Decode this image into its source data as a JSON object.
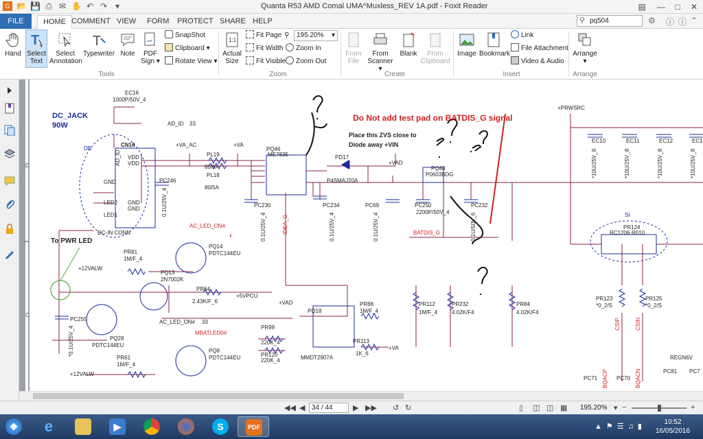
{
  "window": {
    "title": "Quanta R53 AMD Comal UMA^Muxless_REV 1A.pdf - Foxit Reader"
  },
  "menu": {
    "tabs": [
      "FILE",
      "HOME",
      "COMMENT",
      "VIEW",
      "FORM",
      "PROTECT",
      "SHARE",
      "HELP"
    ],
    "active": "HOME",
    "search_value": "pq504"
  },
  "ribbon": {
    "tools": {
      "hand": "Hand",
      "select_text": [
        "Select",
        "Text"
      ],
      "select_annotation": [
        "Select",
        "Annotation"
      ],
      "typewriter": "Typewriter",
      "note": "Note",
      "pdf_sign": [
        "PDF",
        "Sign"
      ],
      "snapshot": "SnapShot",
      "clipboard": "Clipboard",
      "rotate_view": "Rotate View",
      "group": "Tools"
    },
    "zoom": {
      "actual_size": [
        "Actual",
        "Size"
      ],
      "fit_page": "Fit Page",
      "fit_width": "Fit Width",
      "fit_visible": "Fit Visible",
      "zoom_value": "195.20%",
      "zoom_in": "Zoom In",
      "zoom_out": "Zoom Out",
      "group": "Zoom"
    },
    "create": {
      "from_file": [
        "From",
        "File"
      ],
      "from_scanner": [
        "From",
        "Scanner"
      ],
      "blank": "Blank",
      "from_clipboard": [
        "From",
        "Clipboard"
      ],
      "group": "Create"
    },
    "insert": {
      "image": "Image",
      "bookmark": "Bookmark",
      "link": "Link",
      "file_attachment": "File Attachment",
      "video_audio": "Video & Audio",
      "group": "Insert"
    },
    "arrange": {
      "arrange": "Arrange",
      "group": "Arrange"
    }
  },
  "schematic": {
    "labels": {
      "dc_jack": "DC_JACK",
      "w90": "90W",
      "ec16": "EC16",
      "ec16_val": "1000P/50V_4",
      "ad_id": "AD_ID",
      "n33a": "33",
      "db": "DB",
      "cn16": "CN16",
      "ad_id_pin": "AD_ID",
      "vdd1": "VDD",
      "vdd2": "VDD",
      "gnd": "GND",
      "led2": "LED2",
      "led1": "LED1",
      "gnd2": "GND",
      "gnd3": "GND",
      "dcin": "DC-IN CONN",
      "va_ac": "+VA_AC",
      "va": "+VA",
      "pl19": "PL19",
      "pl19_val": "80/5A",
      "pl18": "PL18",
      "pl18_val": "80/5A",
      "pc246": "PC246",
      "pc246_val": "0.1U/25V_4",
      "pq46": "PQ46",
      "pq46_val": "ME7835",
      "pd17": "PD17",
      "pd17_val": "P4SMAJ20A",
      "note1": "Place this ZVS close to",
      "note2": "Diode away +VIN",
      "warning": "Do Not add test pad on BATDIS_G signal",
      "vad": "+VAD",
      "pq48": "PQ48",
      "pq48_val": "P0603BDG",
      "prwsrc": "+PRWSRC",
      "ec10": "EC10",
      "ec11": "EC11",
      "ec12": "EC12",
      "ec1x": "EC1",
      "ec_val": "*10U/25V_8",
      "pc230": "PC230",
      "pc230_val": "0.1U/25V_4",
      "pc234": "PC234",
      "pc234_val": "0.1U/25V_4",
      "pc69": "PC69",
      "pc69_val": "0.1U/25V_4",
      "pc250": "PC250",
      "pc250_val": "2200P/50V_4",
      "pc232": "PC232",
      "pc232_val": "0.1U/50V_6",
      "batdis": "BATDIS_G",
      "idea_g": "IDEA_G",
      "si": "SI",
      "pr124": "PR124",
      "pr124_val": "RC1206-R010",
      "to_pwr_led": "To PWR LED",
      "ac_led_on": "AC_LED_ON#",
      "pq14": "PQ14",
      "pq14_val": "PDTC144EU",
      "pr81": "PR81",
      "pr81_val": "1M/F_4",
      "v12": "+12VALW",
      "pq13": "PQ13",
      "pq13_val": "2N7002K",
      "pr64": "PR64",
      "pr64_val": "2.43K/F_6",
      "v5pcu": "+5VPCU",
      "pc255": "PC255",
      "pc255_val": "*0.1U/25V_4",
      "pq28": "PQ28",
      "pq28_val": "PDTC144EU",
      "ac_led_on2": "AC_LED_ON#",
      "n33b": "33",
      "mbatled": "MBATLED0#",
      "pq8": "PQ8",
      "pq8_val": "PDTC144EU",
      "pr61": "PR61",
      "pr61_val": "1M/F_4",
      "v12b": "+12VALW",
      "vad2": "+VAD",
      "pq18": "PQ18",
      "pr88": "PR88",
      "pr88_val": "1M/F_4",
      "pr112": "PR112",
      "pr112_val": "1M/F_4",
      "pr232": "PR232",
      "pr232_val": "4.02K/F4",
      "pr84": "PR84",
      "pr84_val": "4.02K/F4",
      "pr99": "PR99",
      "pr99_val": "220K_4",
      "pr120": "PR120",
      "pr120_val": "220K_4",
      "mmdt": "MMDT2907A",
      "pr113": "PR113",
      "pr113_val": "1K_6",
      "va2": "+VA",
      "pr123": "PR123",
      "pr123_val": "*0_2/S",
      "pr125": "PR125",
      "pr125_val": "*0_2/S",
      "csip": "CSIP",
      "csin": "CSIN",
      "regn6v": "REGN6V",
      "pc71": "PC71",
      "pc70": "PC70",
      "pc81": "PC81",
      "pc7x": "PC7",
      "bqacp": "BQACP",
      "bqacn": "BQACN",
      "row_d": "D",
      "row_c": "C"
    }
  },
  "status": {
    "page": "34 / 44",
    "zoom": "195.20%"
  },
  "taskbar": {
    "time": "10:52",
    "date": "16/05/2016"
  },
  "colors": {
    "accent": "#2f6db5",
    "schematic_blue": "#1a2a9c",
    "schematic_red": "#d21f1f",
    "trace": "#8a1f4a"
  }
}
